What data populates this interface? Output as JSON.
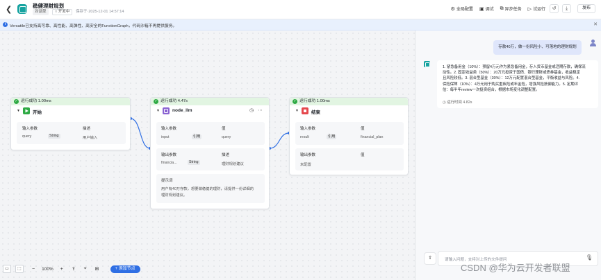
{
  "header": {
    "title": "稳健理财规划",
    "type_badge": "对话型",
    "dev_badge": "○ 开发中",
    "saved_text": "保存于·2025-12-01 14:57:14",
    "actions": [
      {
        "icon": "settings-icon",
        "label": "全局配置"
      },
      {
        "icon": "debug-icon",
        "label": "调试"
      },
      {
        "icon": "async-task-icon",
        "label": "异步任务"
      },
      {
        "icon": "play-icon",
        "label": "试运行"
      }
    ],
    "publish_label": "发布"
  },
  "banner": {
    "text": "Versatile已支持高可靠、高性能、高弹性、高安全的FunctionGraph，代码沙箱不再提供服务。"
  },
  "nodes": {
    "start": {
      "status": "运行成功 1.00ms",
      "name": "开始",
      "input_label": "输入参数",
      "desc_label": "描述",
      "param": "query",
      "type": "String",
      "desc": "用户输入"
    },
    "llm": {
      "status": "运行成功 4.47s",
      "name": "node_llm",
      "input_label": "输入参数",
      "value_label": "值",
      "input_param": "input",
      "input_tag": "引用",
      "input_value": "query",
      "output_label": "输出参数",
      "desc_label": "描述",
      "output_param": "financia...",
      "output_type": "String",
      "output_desc": "理财规划建议",
      "prompt_label": "提示词",
      "prompt_text_1": "用户有40万存款，想要做稳健的理财，请提供一份详细的",
      "prompt_text_2": "理财规划建议。"
    },
    "end": {
      "status": "运行成功 1.00ms",
      "name": "结束",
      "input_label": "输入参数",
      "value_label": "值",
      "input_param": "result",
      "input_tag": "引用",
      "input_value": "financial_plan",
      "output_label": "输出参数",
      "output_value_label": "值",
      "output_empty": "未配置"
    }
  },
  "toolbar": {
    "zoom": "100%",
    "add_node": "+ 添加节点"
  },
  "chat": {
    "user_message": "存款40万，做一份风险小、可落地的理财规划",
    "bot_lines": [
      "1. 紧急备用金（10%）：预留4万元作为紧急备用金，存入货币基金或活期存款，确保流",
      "动性。2. 固定收益类（50%）：20万元投资于国债、银行理财或债券基金，收益稳定",
      "且风险较低。3. 混合型基金（30%）：12万元配置混合型基金，平衡收益与风险。4.",
      "保险保障（10%）：4万元用于购买重疾险或年金险，增强风险抵御能力。5. 定期评",
      "估：每半年review一次投资组合，根据市场变化调整配置。"
    ],
    "run_time": "运行时间 4.82s",
    "input_placeholder": "请输入问题，支持对上传的文件提问"
  },
  "watermark": "CSDN @华为云开发者联盟"
}
